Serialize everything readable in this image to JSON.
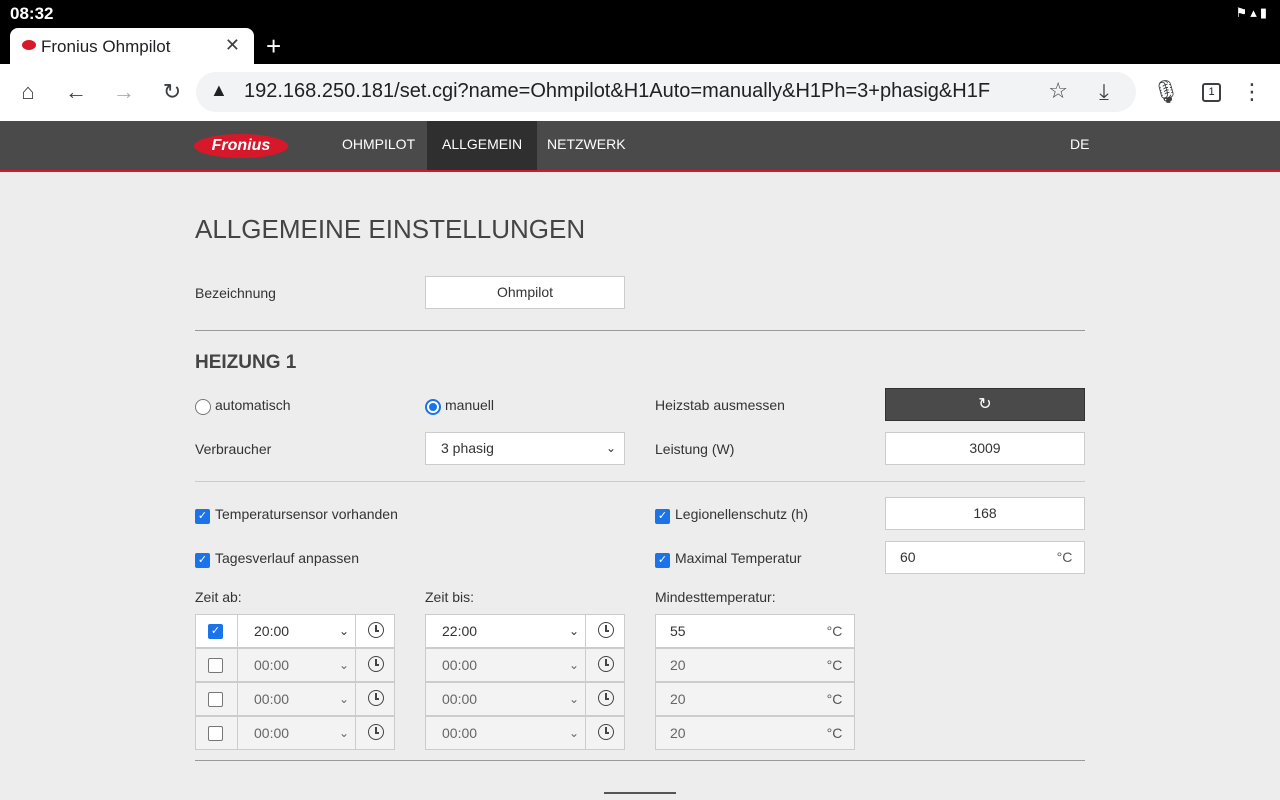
{
  "status": {
    "time": "08:32"
  },
  "browser": {
    "tab_title": "Fronius Ohmpilot",
    "url": "192.168.250.181/set.cgi?name=Ohmpilot&H1Auto=manually&H1Ph=3+phasig&H1F",
    "tab_count": "1"
  },
  "nav": {
    "logo": "Fronius",
    "items": [
      "OHMPILOT",
      "ALLGEMEIN",
      "NETZWERK"
    ],
    "active": "ALLGEMEIN",
    "lang": "DE"
  },
  "page": {
    "title": "ALLGEMEINE EINSTELLUNGEN",
    "bezeichnung_label": "Bezeichnung",
    "bezeichnung_value": "Ohmpilot",
    "heizung_title": "HEIZUNG 1",
    "mode_auto": "automatisch",
    "mode_manual": "manuell",
    "mode_selected": "manuell",
    "heizstab_label": "Heizstab ausmessen",
    "verbraucher_label": "Verbraucher",
    "verbraucher_value": "3 phasig",
    "leistung_label": "Leistung (W)",
    "leistung_value": "3009",
    "tempsensor_label": "Temperatursensor vorhanden",
    "tempsensor_checked": true,
    "legionellen_label": "Legionellenschutz (h)",
    "legionellen_checked": true,
    "legionellen_value": "168",
    "tagesverlauf_label": "Tagesverlauf anpassen",
    "tagesverlauf_checked": true,
    "maxtemp_label": "Maximal Temperatur",
    "maxtemp_checked": true,
    "maxtemp_value": "60",
    "unit_c": "°C",
    "zeit_ab_label": "Zeit ab:",
    "zeit_bis_label": "Zeit bis:",
    "mindesttemp_label": "Mindesttemperatur:",
    "schedule": [
      {
        "enabled": true,
        "from": "20:00",
        "to": "22:00",
        "temp": "55"
      },
      {
        "enabled": false,
        "from": "00:00",
        "to": "00:00",
        "temp": "20"
      },
      {
        "enabled": false,
        "from": "00:00",
        "to": "00:00",
        "temp": "20"
      },
      {
        "enabled": false,
        "from": "00:00",
        "to": "00:00",
        "temp": "20"
      }
    ]
  },
  "colors": {
    "brand_red": "#d7182a",
    "nav_bg": "#4a4a4a",
    "check_blue": "#1a73e8"
  }
}
